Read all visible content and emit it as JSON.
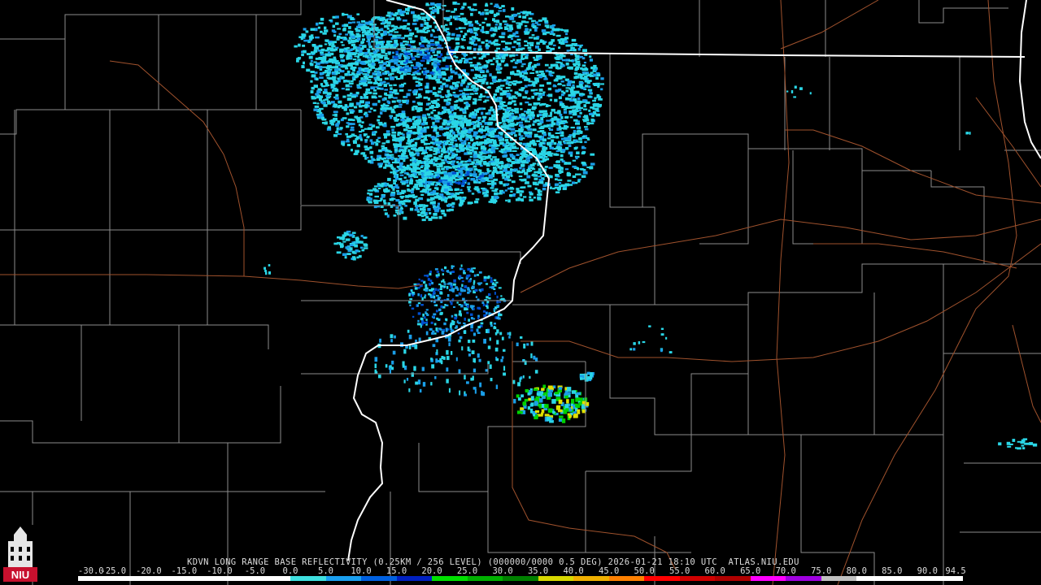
{
  "caption": {
    "station": "KDVN",
    "product": "LONG RANGE BASE REFLECTIVITY (0.25KM / 256 LEVEL) (000000/0000 0.5 DEG)",
    "timestamp": "2026-01-21 18:10 UTC",
    "site": "ATLAS.NIU.EDU"
  },
  "logo": {
    "text": "NIU",
    "icon": "university-tower-icon",
    "color": "#c8102e"
  },
  "colorbar": {
    "labels": [
      "-30.0",
      "-25.0",
      "-20.0",
      "-15.0",
      "-10.0",
      "-5.0",
      "0.0",
      "5.0",
      "10.0",
      "15.0",
      "20.0",
      "25.0",
      "30.0",
      "35.0",
      "40.0",
      "45.0",
      "50.0",
      "55.0",
      "60.0",
      "65.0",
      "70.0",
      "75.0",
      "80.0",
      "85.0",
      "90.0",
      "94.5"
    ],
    "colors": [
      "#ffffff",
      "#ffffff",
      "#ffffff",
      "#ffffff",
      "#ffffff",
      "#ffffff",
      "#3fe0e0",
      "#1aa0f0",
      "#0060e0",
      "#0020c0",
      "#00e000",
      "#00b000",
      "#008000",
      "#d8d800",
      "#f0b000",
      "#ff8000",
      "#ff0000",
      "#d00000",
      "#b00000",
      "#ff00ff",
      "#a000e0",
      "#c0c0c0",
      "#ffffff",
      "#ffffff",
      "#ffffff"
    ]
  },
  "map": {
    "background": "#000000",
    "county_line_color": "#8c8c8c",
    "river_color": "#ffffff",
    "road_color": "#a0522d",
    "echo_colors": [
      "#2ad6e6",
      "#1a9ee8",
      "#0050d0",
      "#00d000",
      "#e0e000"
    ]
  }
}
